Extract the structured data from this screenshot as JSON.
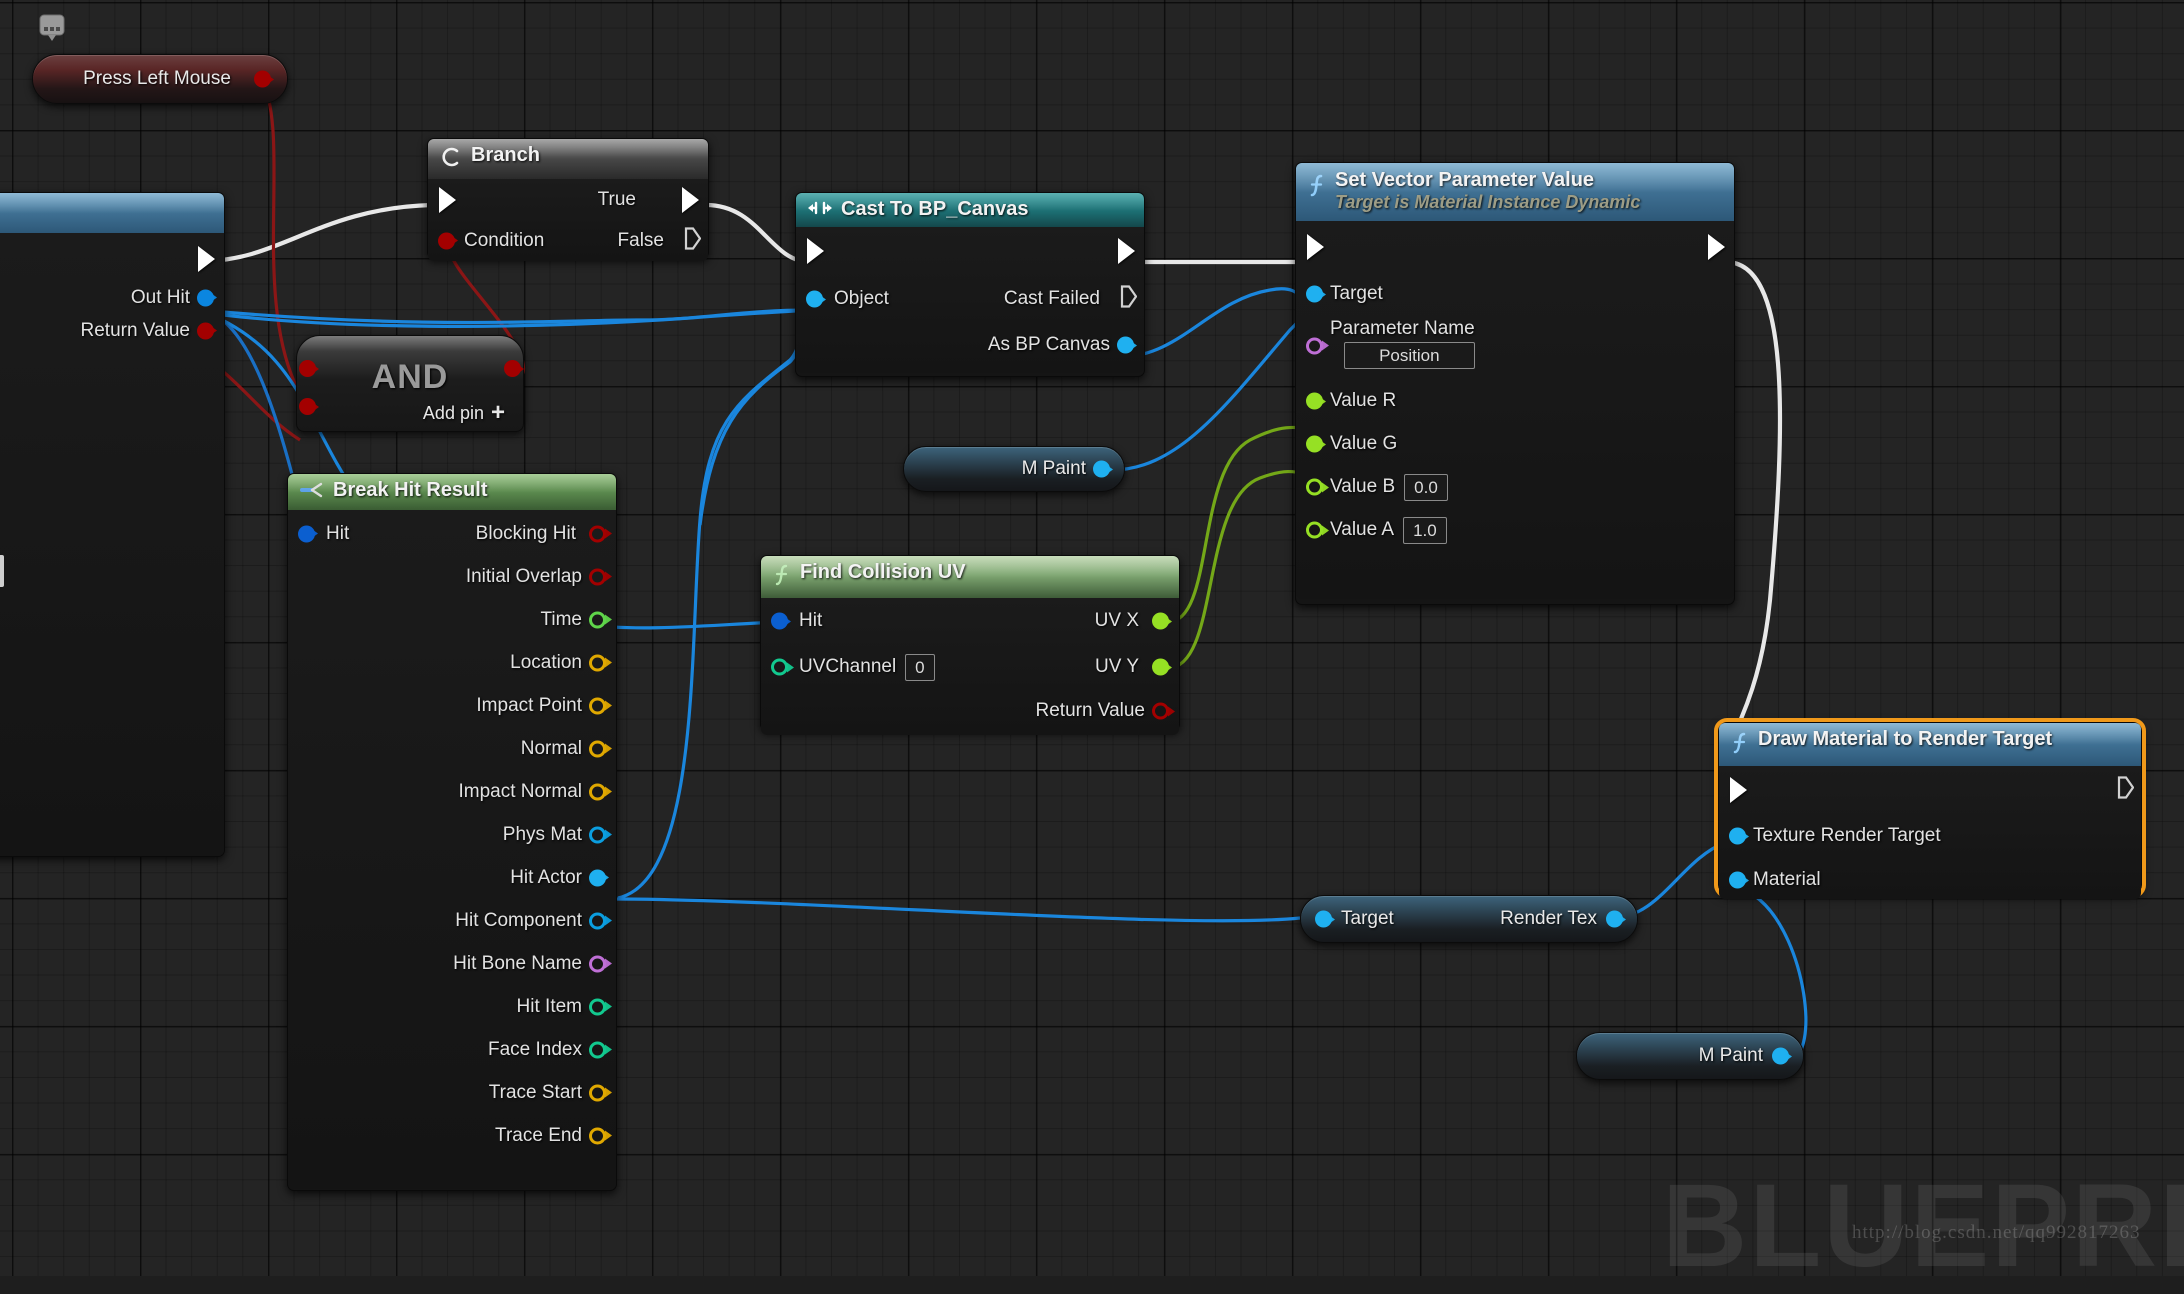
{
  "watermark": {
    "big_text": "BLUEPRIN",
    "url": "http://blog.csdn.net/qq992817263"
  },
  "graph": {
    "background_color": "#242424",
    "grid_color": "#000000",
    "selection_color": "#f0991a"
  },
  "nodes": {
    "event_press_left_mouse": {
      "title": "Press Left Mouse",
      "icon": "mouse-icon",
      "header_color": "#6b3a3a",
      "out_exec_pin": "exec-out"
    },
    "line_trace_partial": {
      "pins": [
        {
          "label": "Out Hit",
          "color": "#0b86e0"
        },
        {
          "label": "Return Value",
          "color": "#a30000"
        }
      ]
    },
    "branch": {
      "title": "Branch",
      "icon": "branch-icon",
      "header_color": "#4a4a4a",
      "inputs": [
        {
          "label": "",
          "type": "exec"
        },
        {
          "label": "Condition",
          "type": "bool",
          "color": "#a30000"
        }
      ],
      "outputs": [
        {
          "label": "True",
          "type": "exec"
        },
        {
          "label": "False",
          "type": "exec-empty"
        }
      ]
    },
    "and_node": {
      "title": "AND",
      "add_pin_label": "Add pin",
      "add_pin_glyph": "+",
      "inputs": [
        {
          "label": "",
          "color": "#a30000"
        },
        {
          "label": "",
          "color": "#a30000"
        }
      ],
      "outputs": [
        {
          "label": "",
          "color": "#a30000"
        }
      ]
    },
    "cast_to_bp_canvas": {
      "title": "Cast To BP_Canvas",
      "icon": "cast-icon",
      "header_color": "#1c6e72",
      "inputs": [
        {
          "label": "",
          "type": "exec"
        },
        {
          "label": "Object",
          "type": "object",
          "color": "#0b86e0"
        }
      ],
      "outputs": [
        {
          "label": "",
          "type": "exec"
        },
        {
          "label": "Cast Failed",
          "type": "exec-empty"
        },
        {
          "label": "As BP Canvas",
          "type": "object",
          "color": "#0b86e0"
        }
      ]
    },
    "break_hit_result": {
      "title": "Break Hit Result",
      "icon": "break-icon",
      "header_color": "#5b8a4e",
      "inputs": [
        {
          "label": "Hit",
          "color": "#0b5fd0",
          "filled": true
        }
      ],
      "outputs": [
        {
          "label": "Blocking Hit",
          "color": "#a30000",
          "filled": false
        },
        {
          "label": "Initial Overlap",
          "color": "#a30000",
          "filled": false
        },
        {
          "label": "Time",
          "color": "#5fd54a",
          "filled": false
        },
        {
          "label": "Location",
          "color": "#e0a800",
          "filled": false
        },
        {
          "label": "Impact Point",
          "color": "#e0a800",
          "filled": false
        },
        {
          "label": "Normal",
          "color": "#e0a800",
          "filled": false
        },
        {
          "label": "Impact Normal",
          "color": "#e0a800",
          "filled": false
        },
        {
          "label": "Phys Mat",
          "color": "#0b9ee0",
          "filled": false
        },
        {
          "label": "Hit Actor",
          "color": "#1fb0f0",
          "filled": true
        },
        {
          "label": "Hit Component",
          "color": "#0b9ee0",
          "filled": false
        },
        {
          "label": "Hit Bone Name",
          "color": "#bf6fd6",
          "filled": false
        },
        {
          "label": "Hit Item",
          "color": "#12c98f",
          "filled": false
        },
        {
          "label": "Face Index",
          "color": "#12c98f",
          "filled": false
        },
        {
          "label": "Trace Start",
          "color": "#e0a800",
          "filled": false
        },
        {
          "label": "Trace End",
          "color": "#e0a800",
          "filled": false
        }
      ]
    },
    "find_collision_uv": {
      "title": "Find Collision UV",
      "icon": "function-icon",
      "header_color": "#7fa772",
      "inputs": [
        {
          "label": "Hit",
          "color": "#0b5fd0",
          "filled": true,
          "value": null
        },
        {
          "label": "UVChannel",
          "color": "#12c98f",
          "filled": false,
          "value": "0"
        }
      ],
      "outputs": [
        {
          "label": "UV X",
          "color": "#96e024",
          "filled": true
        },
        {
          "label": "UV Y",
          "color": "#96e024",
          "filled": true
        },
        {
          "label": "Return Value",
          "color": "#a30000",
          "filled": false
        }
      ]
    },
    "m_paint_top": {
      "label": "M Paint",
      "pin_color": "#1fb0f0"
    },
    "m_paint_bottom": {
      "label": "M Paint",
      "pin_color": "#1fb0f0"
    },
    "set_vector_parameter_value": {
      "title": "Set Vector Parameter Value",
      "subtitle": "Target is Material Instance Dynamic",
      "icon": "function-icon",
      "header_color": "#3f7093",
      "inputs": [
        {
          "label": "",
          "type": "exec"
        },
        {
          "label": "Target",
          "color": "#1fb0f0",
          "filled": true
        },
        {
          "label": "Parameter Name",
          "color": "#bf6fd6",
          "filled": false,
          "value": "Position"
        },
        {
          "label": "Value R",
          "color": "#96e024",
          "filled": true
        },
        {
          "label": "Value G",
          "color": "#96e024",
          "filled": true
        },
        {
          "label": "Value B",
          "color": "#96e024",
          "filled": false,
          "value": "0.0"
        },
        {
          "label": "Value A",
          "color": "#96e024",
          "filled": false,
          "value": "1.0"
        }
      ],
      "outputs": [
        {
          "label": "",
          "type": "exec"
        }
      ]
    },
    "target_render_tex": {
      "input_label": "Target",
      "output_label": "Render Tex",
      "pin_color": "#1fb0f0"
    },
    "draw_material_to_render_target": {
      "title": "Draw Material to Render Target",
      "icon": "function-icon",
      "header_color": "#3f7093",
      "selected": true,
      "inputs": [
        {
          "label": "",
          "type": "exec"
        },
        {
          "label": "Texture Render Target",
          "color": "#1fb0f0",
          "filled": true
        },
        {
          "label": "Material",
          "color": "#1fb0f0",
          "filled": true
        }
      ],
      "outputs": [
        {
          "label": "",
          "type": "exec-empty"
        }
      ]
    }
  }
}
